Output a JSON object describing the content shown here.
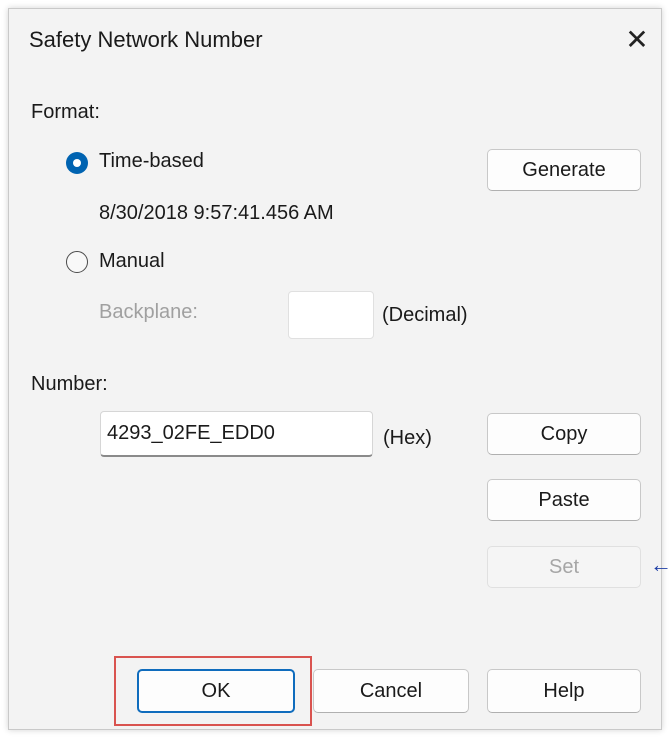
{
  "dialog": {
    "title": "Safety Network Number",
    "close_glyph": "✕"
  },
  "format": {
    "label": "Format:",
    "time_based": {
      "label": "Time-based",
      "selected": true,
      "timestamp": "8/30/2018 9:57:41.456 AM"
    },
    "manual": {
      "label": "Manual",
      "selected": false,
      "backplane_label": "Backplane:",
      "backplane_value": "",
      "decimal_label": "(Decimal)"
    }
  },
  "buttons": {
    "generate": "Generate",
    "copy": "Copy",
    "paste": "Paste",
    "set": "Set",
    "ok": "OK",
    "cancel": "Cancel",
    "help": "Help"
  },
  "number": {
    "label": "Number:",
    "value": "4293_02FE_EDD0",
    "hex_label": "(Hex)"
  },
  "annotations": {
    "arrow_glyph": "←",
    "highlight_color": "#d9534f",
    "arrow_color": "#1f3fa6"
  },
  "colors": {
    "accent": "#0063b1",
    "dialog_bg": "#f3f3f3"
  }
}
